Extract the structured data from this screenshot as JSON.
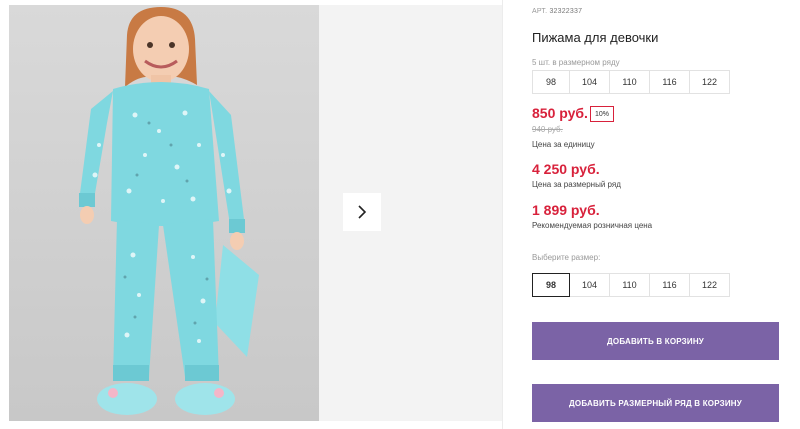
{
  "product": {
    "sku_label": "АРТ.",
    "sku_value": "32322337",
    "title": "Пижама для девочки",
    "pack_label": "5 шт. в размерном ряду",
    "pack_sizes": [
      "98",
      "104",
      "110",
      "116",
      "122"
    ]
  },
  "pricing": {
    "unit_price": "850 руб.",
    "discount": "10%",
    "old_price": "940 руб.",
    "unit_label": "Цена за единицу",
    "pack_price": "4 250 руб.",
    "pack_price_label": "Цена за размерный ряд",
    "retail_price": "1 899 руб.",
    "retail_label": "Рекомендуемая розничная цена"
  },
  "size_picker": {
    "label": "Выберите размер:",
    "sizes": [
      "98",
      "104",
      "110",
      "116",
      "122"
    ],
    "selected": "98"
  },
  "actions": {
    "add_to_cart": "ДОБАВИТЬ В КОРЗИНУ",
    "add_pack_to_cart": "ДОБАВИТЬ РАЗМЕРНЫЙ РЯД В КОРЗИНУ"
  },
  "gallery": {
    "next_icon": "chevron-right-icon"
  },
  "colors": {
    "price_red": "#d8213b",
    "button_purple": "#7b63a6",
    "pajama_turquoise": "#7fd8e0"
  }
}
